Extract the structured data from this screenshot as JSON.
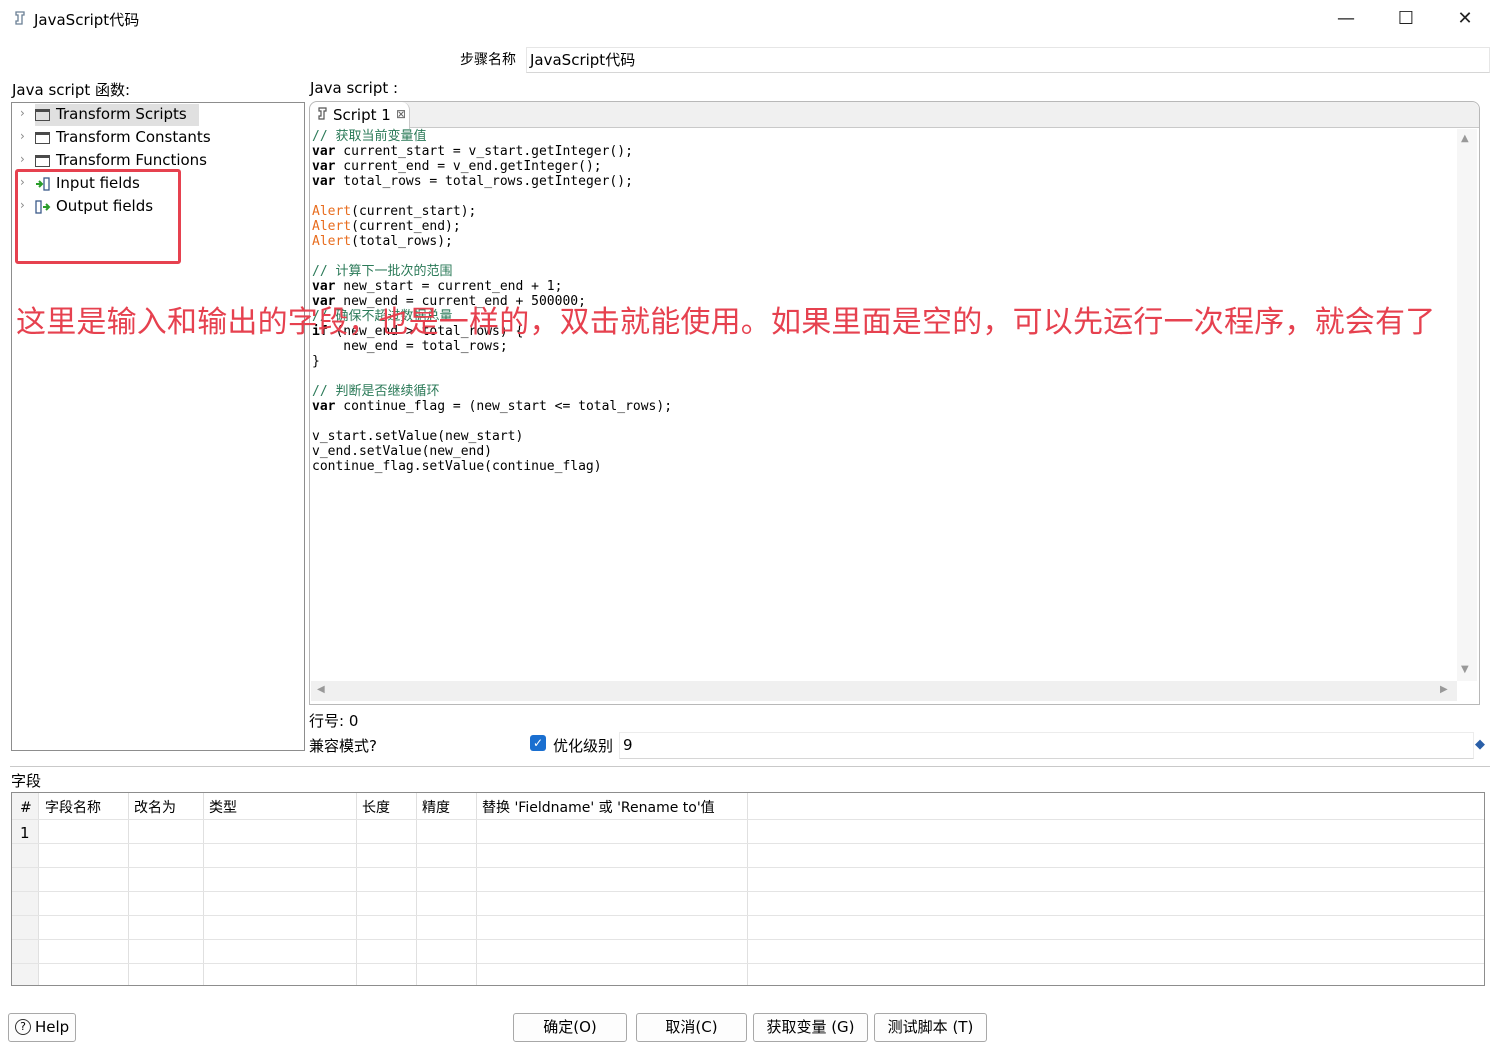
{
  "window": {
    "title": "JavaScript代码",
    "minimize_glyph": "—",
    "maximize_glyph": "☐",
    "close_glyph": "✕"
  },
  "step": {
    "label": "步骤名称",
    "value": "JavaScript代码"
  },
  "left_panel": {
    "label": "Java script 函数:",
    "items": [
      {
        "label": "Transform Scripts",
        "icon": "folder-icon"
      },
      {
        "label": "Transform Constants",
        "icon": "folder-icon"
      },
      {
        "label": "Transform Functions",
        "icon": "folder-icon"
      },
      {
        "label": "Input fields",
        "icon": "input-fields-icon"
      },
      {
        "label": "Output fields",
        "icon": "output-fields-icon"
      }
    ]
  },
  "editor": {
    "label": "Java script :",
    "tab_label": "Script 1",
    "code_lines": [
      "// 获取当前变量值",
      "var current_start = v_start.getInteger();",
      "var current_end = v_end.getInteger();",
      "var total_rows = total_rows.getInteger();",
      "",
      "Alert(current_start);",
      "Alert(current_end);",
      "Alert(total_rows);",
      "",
      "// 计算下一批次的范围",
      "var new_start = current_end + 1;",
      "var new_end = current_end + 500000;",
      "// 确保不超过数据总量",
      "if (new_end > total_rows) {",
      "    new_end = total_rows;",
      "}",
      "",
      "// 判断是否继续循环",
      "var continue_flag = (new_start <= total_rows);",
      "",
      "v_start.setValue(new_start)",
      "v_end.setValue(new_end)",
      "continue_flag.setValue(continue_flag)"
    ]
  },
  "status": {
    "row_label": "行号: 0",
    "compat_label": "兼容模式?",
    "opt_label": "优化级别",
    "opt_checked": true,
    "opt_value": "9"
  },
  "fields": {
    "label": "字段",
    "columns": [
      "#",
      "字段名称",
      "改名为",
      "类型",
      "长度",
      "精度",
      "替换 'Fieldname' 或 'Rename to'值"
    ],
    "rows": [
      [
        "1",
        "",
        "",
        "",
        "",
        "",
        ""
      ]
    ]
  },
  "annotation": {
    "text": "这里是输入和输出的字段，也是一样的，双击就能使用。如果里面是空的，可以先运行一次程序，就会有了",
    "color": "#e6414f"
  },
  "buttons": {
    "help": "Help",
    "ok": "确定(O)",
    "cancel": "取消(C)",
    "get_vars": "获取变量 (G)",
    "test": "测试脚本 (T)"
  }
}
